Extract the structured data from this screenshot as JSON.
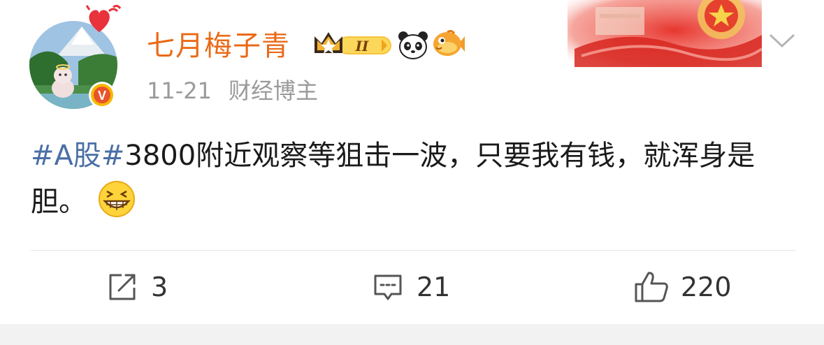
{
  "user": {
    "name": "七月梅子青",
    "time": "11-21",
    "title": "财经博主",
    "verified_badge": "V",
    "crown_level": "II"
  },
  "post": {
    "topic": "#A股#",
    "text": "3800附近观察等狙击一波，只要我有钱，就浑身是胆。",
    "emoji": "grin-emoji"
  },
  "actions": {
    "repost_count": "3",
    "comment_count": "21",
    "like_count": "220"
  },
  "icons": {
    "header_menu": "chevron-down-icon",
    "repost": "repost-icon",
    "comment": "comment-icon",
    "like": "thumbs-up-icon"
  },
  "colors": {
    "username": "#ea6a16",
    "topic": "#4a6fa6",
    "meta": "#9a9a9a",
    "badge_red": "#e8532b",
    "badge_gold": "#f5b800"
  }
}
